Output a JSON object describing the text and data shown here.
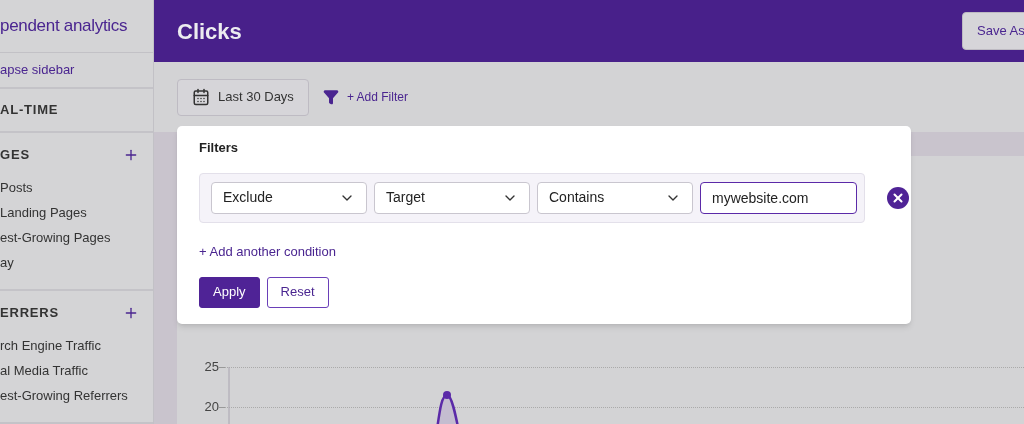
{
  "sidebar": {
    "logo": "pendent analytics",
    "collapse_link": "apse sidebar",
    "sections": [
      {
        "title": "AL-TIME"
      },
      {
        "title": "GES",
        "addable": true,
        "items": [
          "Posts",
          "Landing Pages",
          "est-Growing Pages",
          "ay"
        ]
      },
      {
        "title": "ERRERS",
        "addable": true,
        "items": [
          "rch Engine Traffic",
          "al Media Traffic",
          "est-Growing Referrers"
        ]
      }
    ]
  },
  "header": {
    "title": "Clicks",
    "save_button": "Save As"
  },
  "toolbar": {
    "date_range": "Last 30 Days",
    "add_filter": "+ Add Filter"
  },
  "filter_panel": {
    "title": "Filters",
    "conditions": [
      {
        "fields": [
          {
            "kind": "select",
            "value": "Exclude"
          },
          {
            "kind": "select",
            "value": "Target"
          },
          {
            "kind": "select",
            "value": "Contains"
          },
          {
            "kind": "input",
            "value": "mywebsite.com",
            "focused": true
          }
        ]
      }
    ],
    "add_condition": "+ Add another condition",
    "buttons": [
      {
        "label": "Apply",
        "primary": true
      },
      {
        "label": "Reset",
        "primary": false
      }
    ]
  },
  "chart": {
    "y_labels": [
      "25",
      "20"
    ]
  }
}
